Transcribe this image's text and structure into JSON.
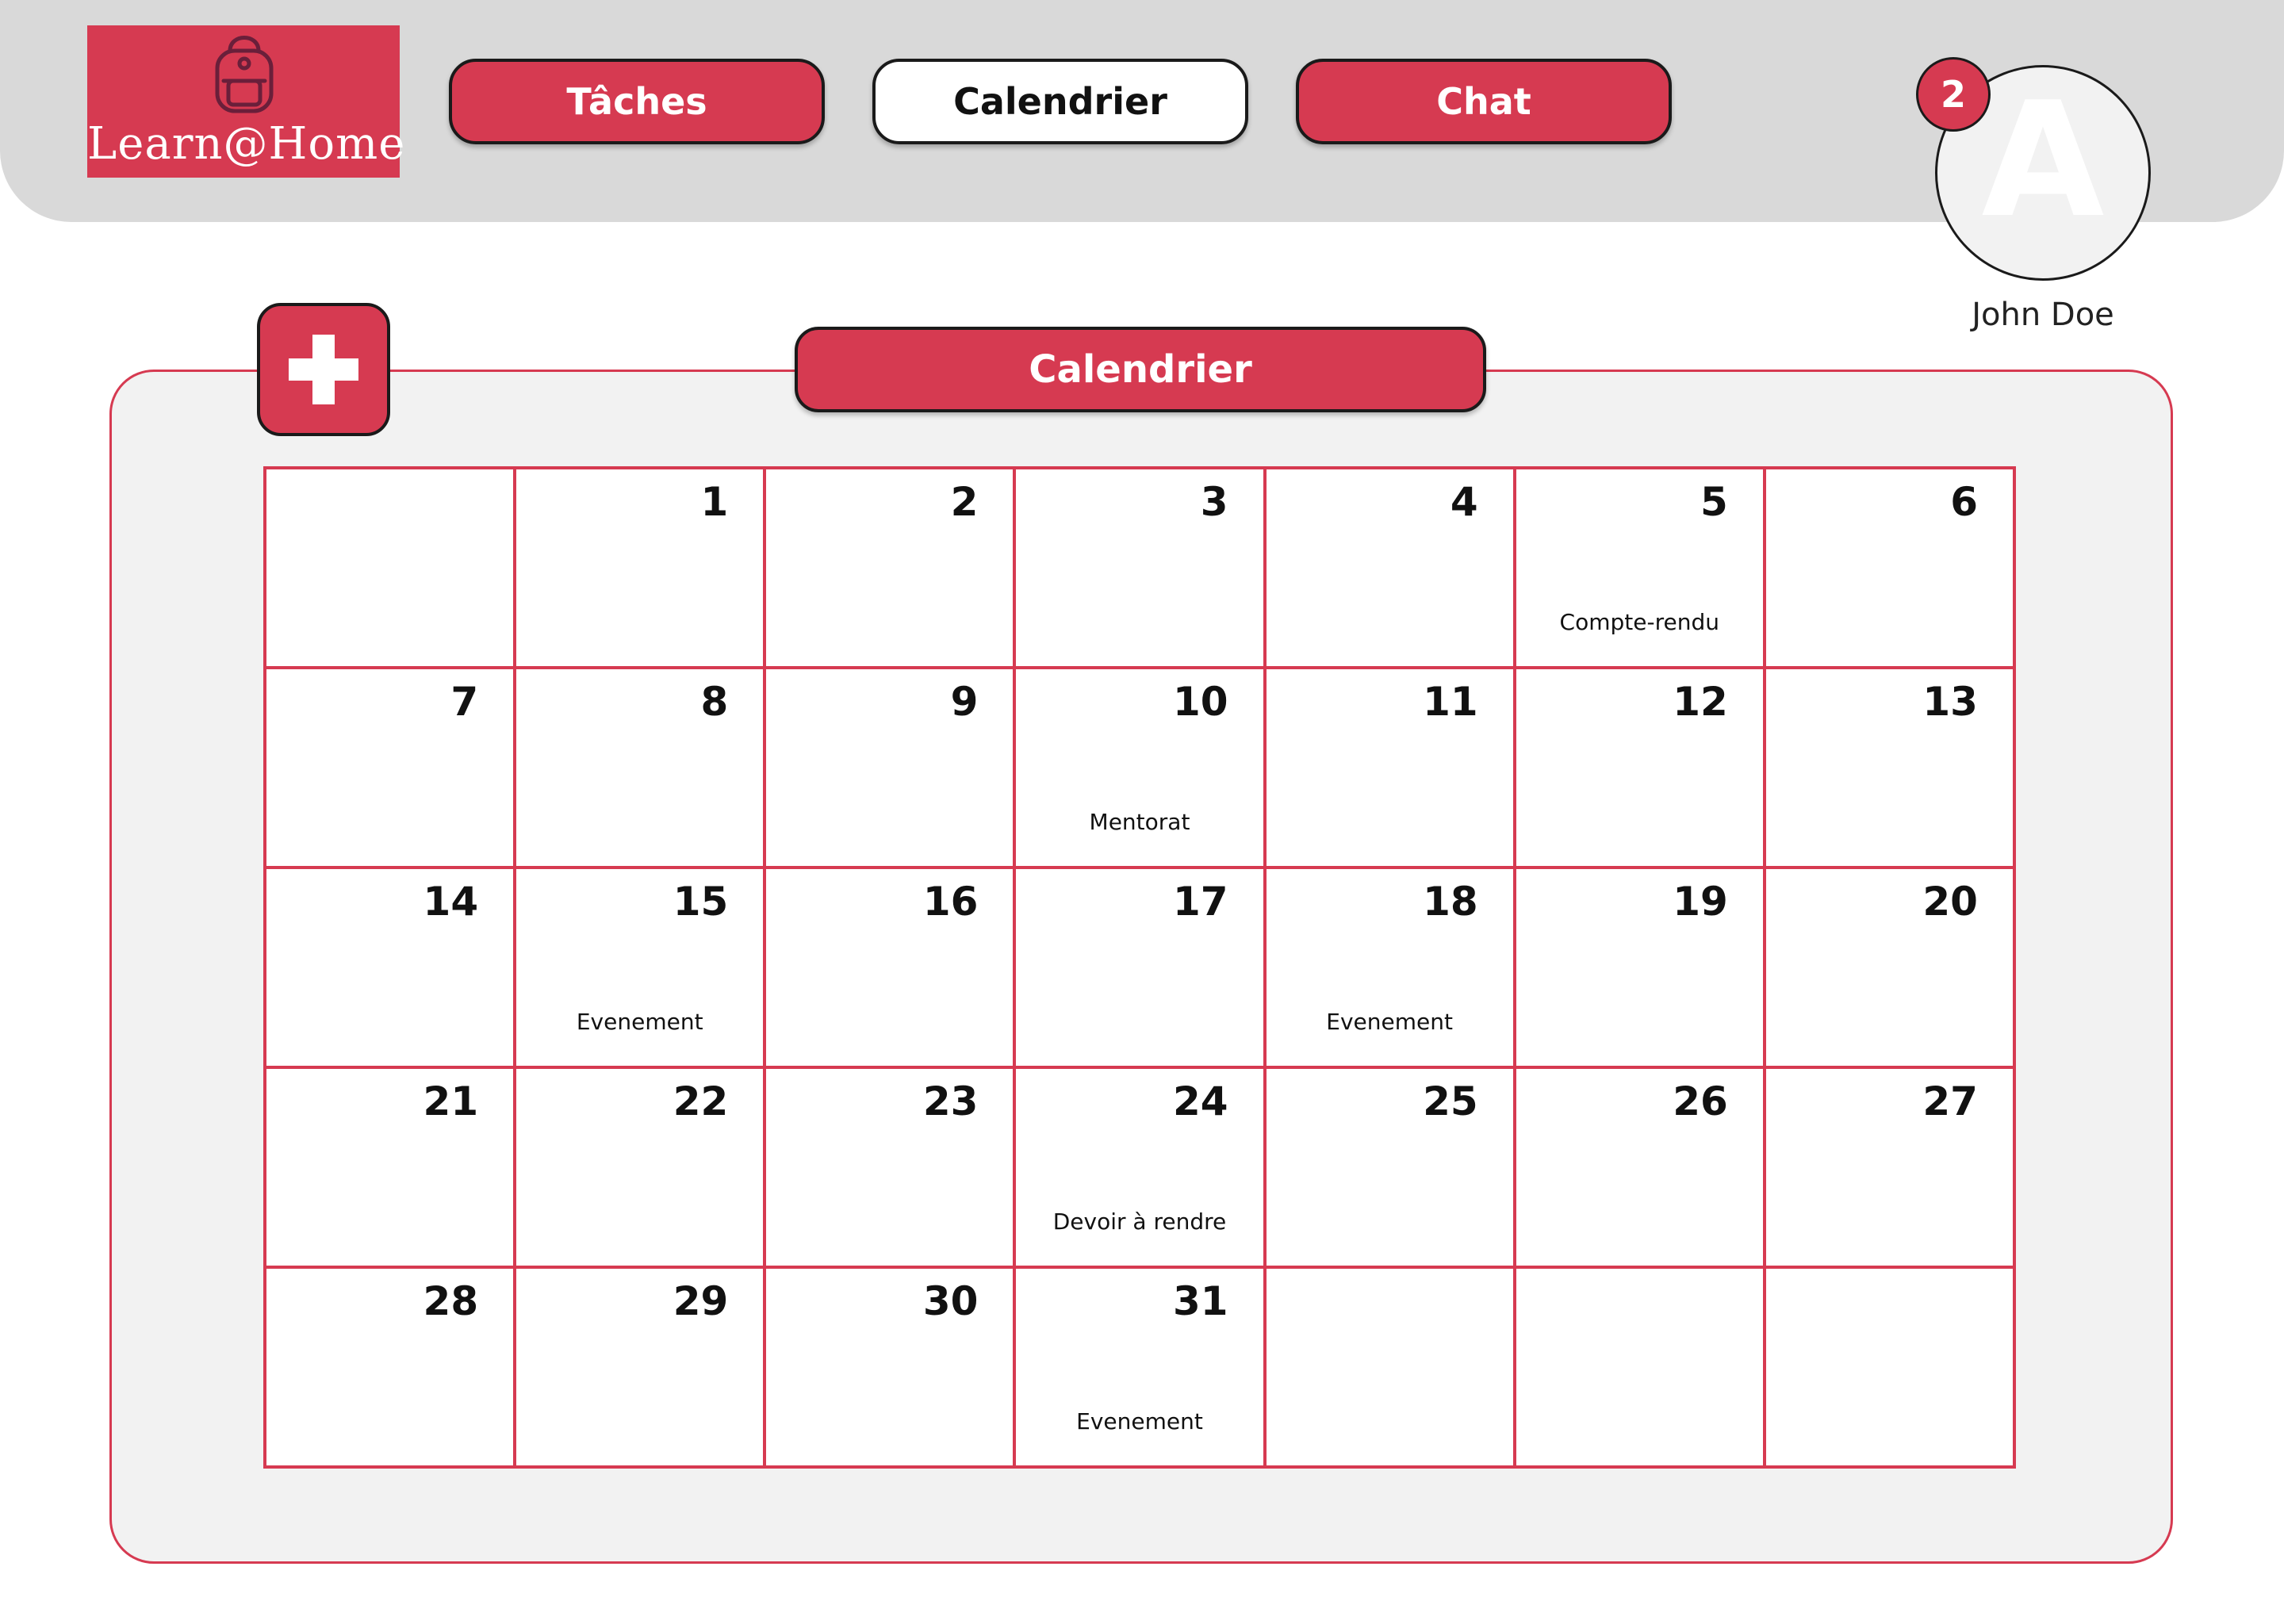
{
  "header": {
    "brand": "Learn@Home",
    "nav": [
      {
        "label": "Tâches",
        "active": false
      },
      {
        "label": "Calendrier",
        "active": true
      },
      {
        "label": "Chat",
        "active": false
      }
    ],
    "notification_count": "2",
    "avatar_initial": "A",
    "username": "John Doe"
  },
  "calendar": {
    "title": "Calendrier",
    "cells": [
      {
        "day": "",
        "event": ""
      },
      {
        "day": "1",
        "event": ""
      },
      {
        "day": "2",
        "event": ""
      },
      {
        "day": "3",
        "event": ""
      },
      {
        "day": "4",
        "event": ""
      },
      {
        "day": "5",
        "event": "Compte-rendu"
      },
      {
        "day": "6",
        "event": ""
      },
      {
        "day": "7",
        "event": ""
      },
      {
        "day": "8",
        "event": ""
      },
      {
        "day": "9",
        "event": ""
      },
      {
        "day": "10",
        "event": "Mentorat"
      },
      {
        "day": "11",
        "event": ""
      },
      {
        "day": "12",
        "event": ""
      },
      {
        "day": "13",
        "event": ""
      },
      {
        "day": "14",
        "event": ""
      },
      {
        "day": "15",
        "event": "Evenement"
      },
      {
        "day": "16",
        "event": ""
      },
      {
        "day": "17",
        "event": ""
      },
      {
        "day": "18",
        "event": "Evenement"
      },
      {
        "day": "19",
        "event": ""
      },
      {
        "day": "20",
        "event": ""
      },
      {
        "day": "21",
        "event": ""
      },
      {
        "day": "22",
        "event": ""
      },
      {
        "day": "23",
        "event": ""
      },
      {
        "day": "24",
        "event": "Devoir à rendre"
      },
      {
        "day": "25",
        "event": ""
      },
      {
        "day": "26",
        "event": ""
      },
      {
        "day": "27",
        "event": ""
      },
      {
        "day": "28",
        "event": ""
      },
      {
        "day": "29",
        "event": ""
      },
      {
        "day": "30",
        "event": ""
      },
      {
        "day": "31",
        "event": "Evenement"
      },
      {
        "day": "",
        "event": ""
      },
      {
        "day": "",
        "event": ""
      },
      {
        "day": "",
        "event": ""
      }
    ]
  },
  "colors": {
    "accent": "#d63a51",
    "header_bg": "#d9d9d9",
    "panel_bg": "#f2f2f2"
  },
  "icons": {
    "logo": "backpack-icon",
    "add": "plus-icon"
  }
}
